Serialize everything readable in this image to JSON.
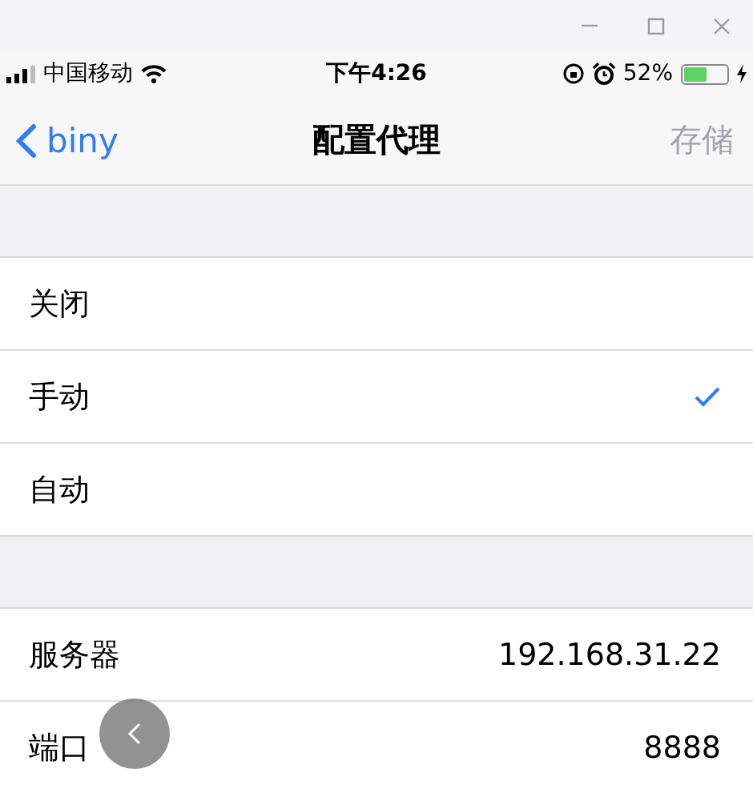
{
  "status_bar": {
    "carrier": "中国移动",
    "time": "下午4:26",
    "battery": "52%"
  },
  "nav": {
    "back": "biny",
    "title": "配置代理",
    "save": {
      "label": "存储",
      "disabled": true
    }
  },
  "proxy_modes": [
    {
      "label": "关闭",
      "selected": false
    },
    {
      "label": "手动",
      "selected": true
    },
    {
      "label": "自动",
      "selected": false
    }
  ],
  "fields": [
    {
      "label": "服务器",
      "value": "192.168.31.22"
    },
    {
      "label": "端口",
      "value": "8888"
    }
  ]
}
